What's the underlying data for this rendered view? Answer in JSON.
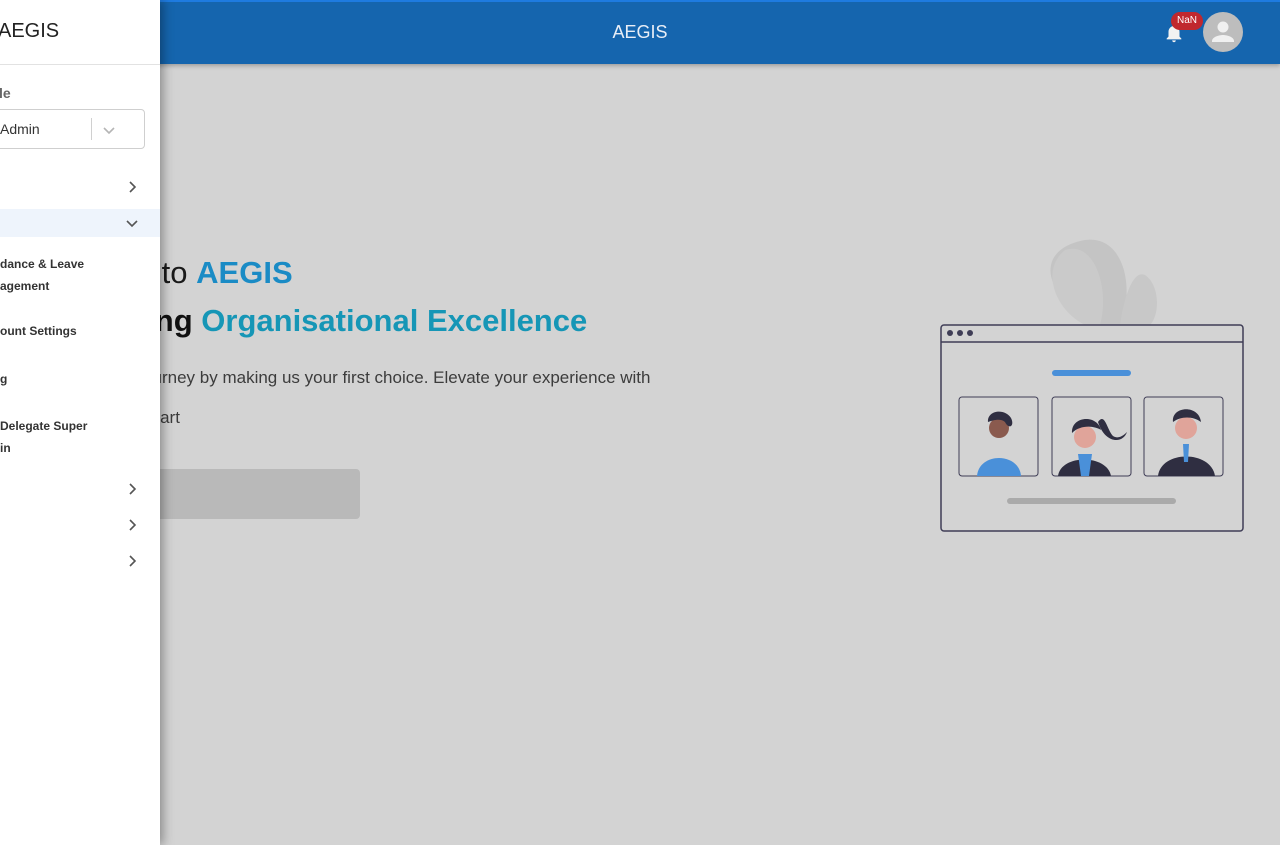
{
  "header": {
    "title": "AEGIS",
    "notification_badge": "NaN"
  },
  "hero": {
    "line1_prefix": "me to ",
    "line1_brand": "AEGIS",
    "line2_prefix": "shing ",
    "line2_accent": "Organisational Excellence",
    "description": "our journey by making us your first choice. Elevate your experience with",
    "start_text": "Lets start"
  },
  "sidebar": {
    "title": "AEGIS",
    "role_label": "le",
    "role_value": "Admin",
    "items": [
      {
        "label": "",
        "expanded": false
      },
      {
        "label": "",
        "expanded": true
      },
      {
        "label_line1": "dance & Leave",
        "label_line2": "agement"
      },
      {
        "label": "ount Settings"
      },
      {
        "label": "g"
      },
      {
        "label_line1": "Delegate Super",
        "label_line2": "in"
      },
      {
        "label": "",
        "expanded": false
      },
      {
        "label": "",
        "expanded": false
      },
      {
        "label": "",
        "expanded": false
      }
    ]
  },
  "colors": {
    "app_bar": "#1565ae",
    "brand_accent": "#1a8bc5",
    "badge": "#c0282e",
    "overlay_bg": "#d3d3d3"
  }
}
